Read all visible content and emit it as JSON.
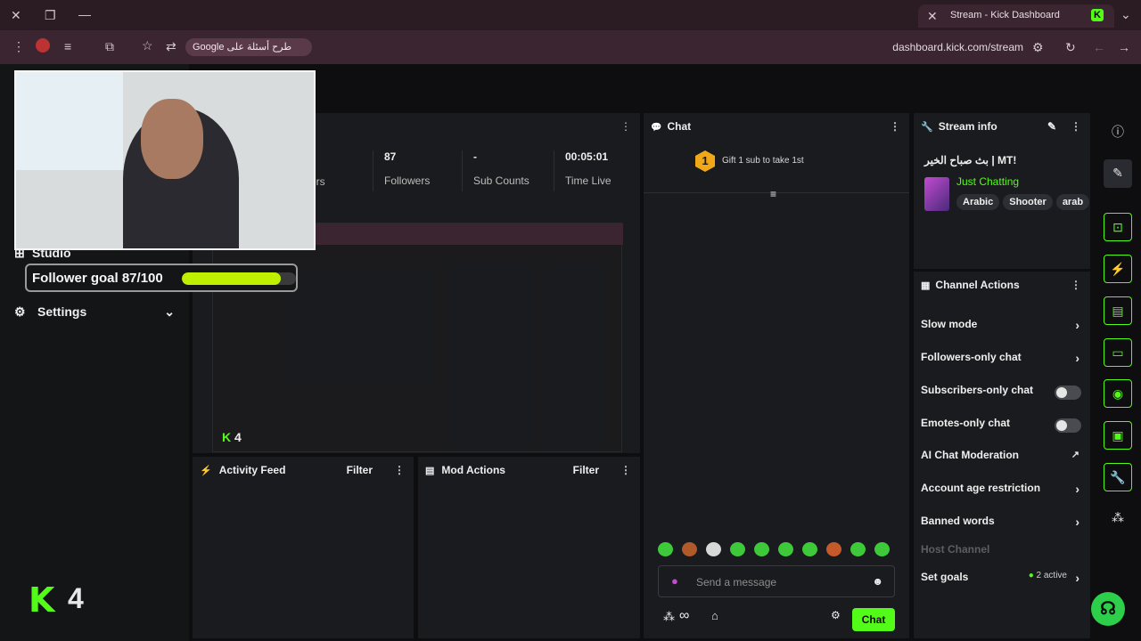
{
  "browser": {
    "tab_title": "Stream - Kick Dashboard",
    "tab_favicon": "K",
    "url": "dashboard.kick.com/stream",
    "search_pill": "Google طرح أسئلة على",
    "icons": [
      "close-icon",
      "restore-icon",
      "minimize-icon",
      "new-tab-icon",
      "menu-icon",
      "star-icon",
      "reload-icon"
    ]
  },
  "nav": {
    "studio": "Studio",
    "settings": "Settings"
  },
  "stats": [
    {
      "value": "",
      "label": "ers"
    },
    {
      "value": "87",
      "label": "Followers"
    },
    {
      "value": "-",
      "label": "Sub Counts"
    },
    {
      "value": "00:05:01",
      "label": "Time Live"
    }
  ],
  "preview": {
    "viewer_count": "4"
  },
  "activity": {
    "title": "Activity Feed",
    "filter": "Filter"
  },
  "mod": {
    "title": "Mod Actions",
    "filter": "Filter"
  },
  "chat": {
    "title": "Chat",
    "gift_text": "Gift 1 sub to take 1st",
    "badge": "1",
    "placeholder": "Send a message",
    "send_label": "Chat",
    "infinity": "∞"
  },
  "stream_info": {
    "title": "Stream info",
    "stream_title": "بث صباح الخير | MT!",
    "category": "Just Chatting",
    "tags": [
      "Arabic",
      "Shooter",
      "arab"
    ]
  },
  "channel_actions": {
    "title": "Channel Actions",
    "items": [
      {
        "label": "Slow mode",
        "kind": "chevron"
      },
      {
        "label": "Followers-only chat",
        "kind": "chevron"
      },
      {
        "label": "Subscribers-only chat",
        "kind": "toggle"
      },
      {
        "label": "Emotes-only chat",
        "kind": "toggle"
      },
      {
        "label": "AI Chat Moderation",
        "kind": "external"
      },
      {
        "label": "Account age restriction",
        "kind": "chevron"
      },
      {
        "label": "Banned words",
        "kind": "chevron"
      },
      {
        "label": "Host Channel",
        "kind": "disabled"
      },
      {
        "label": "Set goals",
        "kind": "chevron",
        "extra": "2 active"
      }
    ]
  },
  "overlay": {
    "goal_text": "Follower goal 87/100",
    "goal_progress": 0.87,
    "kick_letter": "K",
    "kick_count": "4"
  },
  "colors": {
    "accent": "#53fc18",
    "goal_fill": "#bff000"
  }
}
